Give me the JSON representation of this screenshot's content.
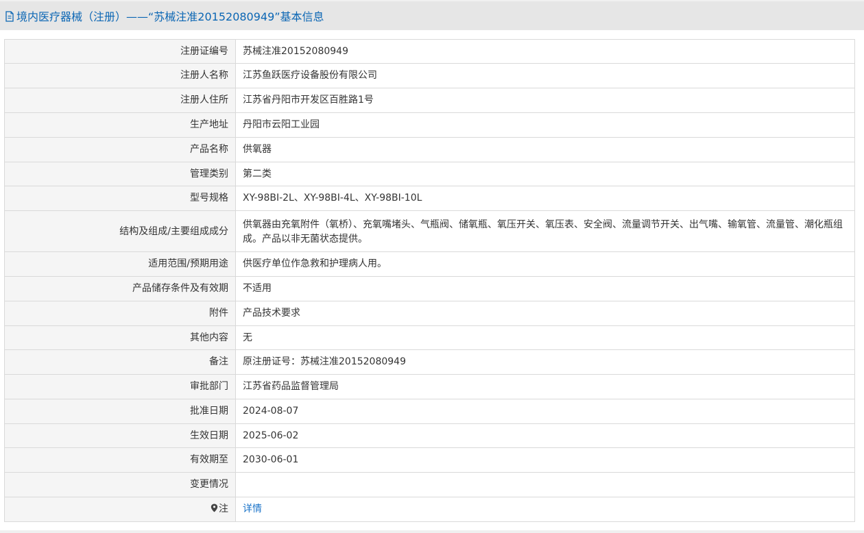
{
  "header": {
    "title": "境内医疗器械（注册）——“苏械注准20152080949”基本信息",
    "icon": "document-icon"
  },
  "colors": {
    "title": "#0b66b4",
    "link": "#1a73c8",
    "label_bg": "#f5f5f5",
    "border": "#d9d9d9"
  },
  "rows": [
    {
      "label": "注册证编号",
      "value": "苏械注准20152080949"
    },
    {
      "label": "注册人名称",
      "value": "江苏鱼跃医疗设备股份有限公司"
    },
    {
      "label": "注册人住所",
      "value": "江苏省丹阳市开发区百胜路1号"
    },
    {
      "label": "生产地址",
      "value": "丹阳市云阳工业园"
    },
    {
      "label": "产品名称",
      "value": "供氧器"
    },
    {
      "label": "管理类别",
      "value": "第二类"
    },
    {
      "label": "型号规格",
      "value": "XY-98BI-2L、XY-98BI-4L、XY-98BI-10L"
    },
    {
      "label": "结构及组成/主要组成成分",
      "value": "供氧器由充氧附件（氧桥）、充氧嘴堵头、气瓶阀、储氧瓶、氧压开关、氧压表、安全阀、流量调节开关、出气嘴、输氧管、流量管、潮化瓶组成。产品以非无菌状态提供。"
    },
    {
      "label": "适用范围/预期用途",
      "value": "供医疗单位作急救和护理病人用。"
    },
    {
      "label": "产品储存条件及有效期",
      "value": "不适用"
    },
    {
      "label": "附件",
      "value": "产品技术要求"
    },
    {
      "label": "其他内容",
      "value": "无"
    },
    {
      "label": "备注",
      "value": "原注册证号：苏械注准20152080949"
    },
    {
      "label": "审批部门",
      "value": "江苏省药品监督管理局"
    },
    {
      "label": "批准日期",
      "value": "2024-08-07"
    },
    {
      "label": "生效日期",
      "value": "2025-06-02"
    },
    {
      "label": "有效期至",
      "value": "2030-06-01"
    },
    {
      "label": "变更情况",
      "value": ""
    }
  ],
  "note": {
    "label": "注",
    "icon": "map-pin-icon",
    "link_text": "详情"
  }
}
